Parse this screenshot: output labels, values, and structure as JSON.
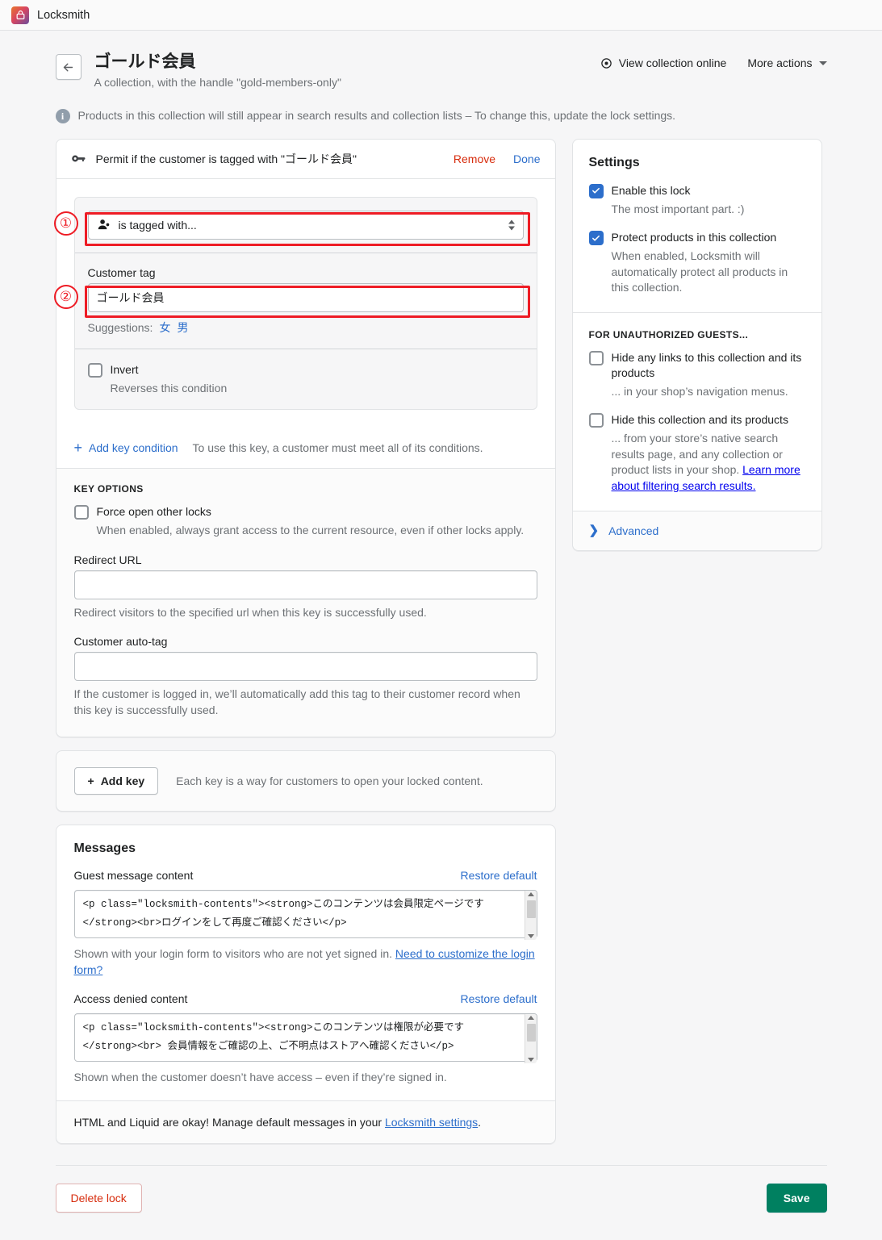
{
  "appbar": {
    "title": "Locksmith",
    "icon": "lock-icon"
  },
  "header": {
    "back_icon": "arrow-left-icon",
    "title": "ゴールド会員",
    "subtitle": "A collection, with the handle \"gold-members-only\"",
    "view_online_label": "View collection online",
    "view_online_icon": "eye-icon",
    "more_actions_label": "More actions",
    "more_actions_icon": "chevron-down-icon"
  },
  "info_banner": {
    "icon": "info-icon",
    "text": "Products in this collection will still appear in search results and collection lists – To change this, update the lock settings."
  },
  "key_card": {
    "icon": "key-icon",
    "title": "Permit if the customer is tagged with \"ゴールド会員\"",
    "remove_label": "Remove",
    "done_label": "Done",
    "condition": {
      "select_icon": "customer-icon",
      "select_value": "is tagged with...",
      "select_arrows_icon": "up-down-arrows-icon",
      "tag_label": "Customer tag",
      "tag_value": "ゴールド会員",
      "suggestions_label": "Suggestions:",
      "suggestions": [
        "女",
        "男"
      ],
      "invert_label": "Invert",
      "invert_help": "Reverses this condition",
      "invert_checked": false
    },
    "add_condition_label": "Add key condition",
    "add_condition_icon": "plus-icon",
    "add_condition_hint": "To use this key, a customer must meet all of its conditions.",
    "key_options": {
      "section_title": "KEY OPTIONS",
      "force_open_label": "Force open other locks",
      "force_open_checked": false,
      "force_open_help": "When enabled, always grant access to the current resource, even if other locks apply.",
      "redirect_label": "Redirect URL",
      "redirect_value": "",
      "redirect_help": "Redirect visitors to the specified url when this key is successfully used.",
      "autotag_label": "Customer auto-tag",
      "autotag_value": "",
      "autotag_help": "If the customer is logged in, we’ll automatically add this tag to their customer record when this key is successfully used."
    }
  },
  "add_key": {
    "button_label": "Add key",
    "button_icon": "plus-icon",
    "hint": "Each key is a way for customers to open your locked content."
  },
  "messages": {
    "title": "Messages",
    "guest": {
      "label": "Guest message content",
      "restore_label": "Restore default",
      "value": "<p class=\"locksmith-contents\"><strong>このコンテンツは会員限定ページです</strong><br>ログインをして再度ご確認ください</p>",
      "help": "Shown with your login form to visitors who are not yet signed in.",
      "help_link": "Need to customize the login form?"
    },
    "denied": {
      "label": "Access denied content",
      "restore_label": "Restore default",
      "value": "<p class=\"locksmith-contents\"><strong>このコンテンツは権限が必要です</strong><br> 会員情報をご確認の上、ご不明点はストアへ確認ください</p>",
      "help": "Shown when the customer doesn’t have access – even if they’re signed in."
    },
    "footer_text": "HTML and Liquid are okay! Manage default messages in your ",
    "footer_link": "Locksmith settings",
    "footer_tail": "."
  },
  "settings": {
    "title": "Settings",
    "enable_lock": {
      "label": "Enable this lock",
      "help": "The most important part. :)",
      "checked": true
    },
    "protect_products": {
      "label": "Protect products in this collection",
      "help": "When enabled, Locksmith will automatically protect all products in this collection.",
      "checked": true
    },
    "guests_section_title": "FOR UNAUTHORIZED GUESTS...",
    "hide_links": {
      "label": "Hide any links to this collection and its products",
      "help": "... in your shop’s navigation menus.",
      "checked": false
    },
    "hide_collection": {
      "label": "Hide this collection and its products",
      "help": "... from your store’s native search results page, and any collection or product lists in your shop. ",
      "help_link": "Learn more about filtering search results.",
      "checked": false
    },
    "advanced_label": "Advanced",
    "advanced_icon": "chevron-right-icon"
  },
  "footer": {
    "delete_label": "Delete lock",
    "save_label": "Save"
  },
  "annotations": {
    "one": "①",
    "two": "②"
  },
  "colors": {
    "accent_link": "#2c6ecb",
    "danger": "#d72c0d",
    "save_green": "#008060",
    "annotation_red": "#ee1c25",
    "checkbox_blue": "#2c6ecb"
  }
}
